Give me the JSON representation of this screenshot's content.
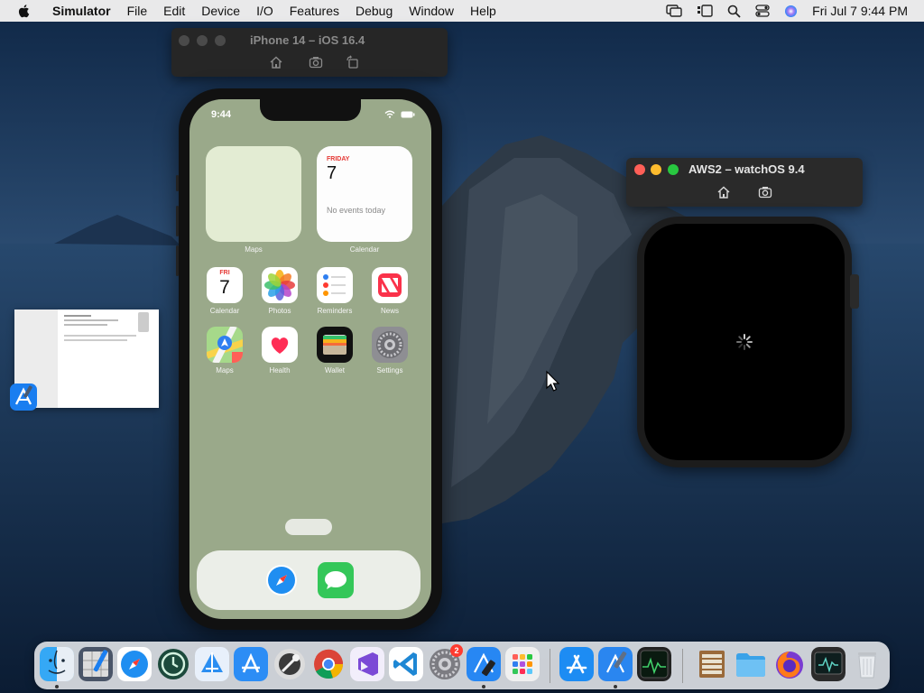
{
  "menubar": {
    "app_name": "Simulator",
    "menus": [
      "File",
      "Edit",
      "Device",
      "I/O",
      "Features",
      "Debug",
      "Window",
      "Help"
    ],
    "clock": "Fri Jul 7  9:44 PM"
  },
  "iphone_window": {
    "title": "iPhone 14 – iOS 16.4",
    "status_time": "9:44",
    "widgets": {
      "maps_label": "Maps",
      "calendar_label": "Calendar",
      "calendar_day": "FRIDAY",
      "calendar_date": "7",
      "calendar_empty": "No events today"
    },
    "apps_row1": [
      {
        "label": "Calendar",
        "icon": "calendar-icon",
        "day": "FRI",
        "date": "7"
      },
      {
        "label": "Photos",
        "icon": "photos-icon"
      },
      {
        "label": "Reminders",
        "icon": "reminders-icon"
      },
      {
        "label": "News",
        "icon": "news-icon"
      }
    ],
    "apps_row2": [
      {
        "label": "Maps",
        "icon": "maps-icon"
      },
      {
        "label": "Health",
        "icon": "health-icon"
      },
      {
        "label": "Wallet",
        "icon": "wallet-icon"
      },
      {
        "label": "Settings",
        "icon": "settings-icon"
      }
    ],
    "dock": [
      "Safari",
      "Messages"
    ]
  },
  "watch_window": {
    "title": "AWS2 – watchOS 9.4"
  },
  "dock": {
    "badge_count": "2",
    "items": [
      "Finder",
      "Xcode",
      "Safari",
      "Time Machine",
      "Instruments",
      "App Store Connect",
      "Simulator Tools",
      "Chrome",
      "Visual Studio",
      "VS Code",
      "System Settings",
      "Xcode Beta",
      "Launchpad",
      "App Store",
      "Xcode Build",
      "Activity Monitor",
      "Archive",
      "Folder",
      "Firefox",
      "Console",
      "Trash"
    ]
  },
  "colors": {
    "menubar_bg": "#e9e9ea",
    "toolbar_bg": "#262626",
    "close": "#ff5f57",
    "minimize": "#febc2e",
    "zoom": "#28c840"
  }
}
